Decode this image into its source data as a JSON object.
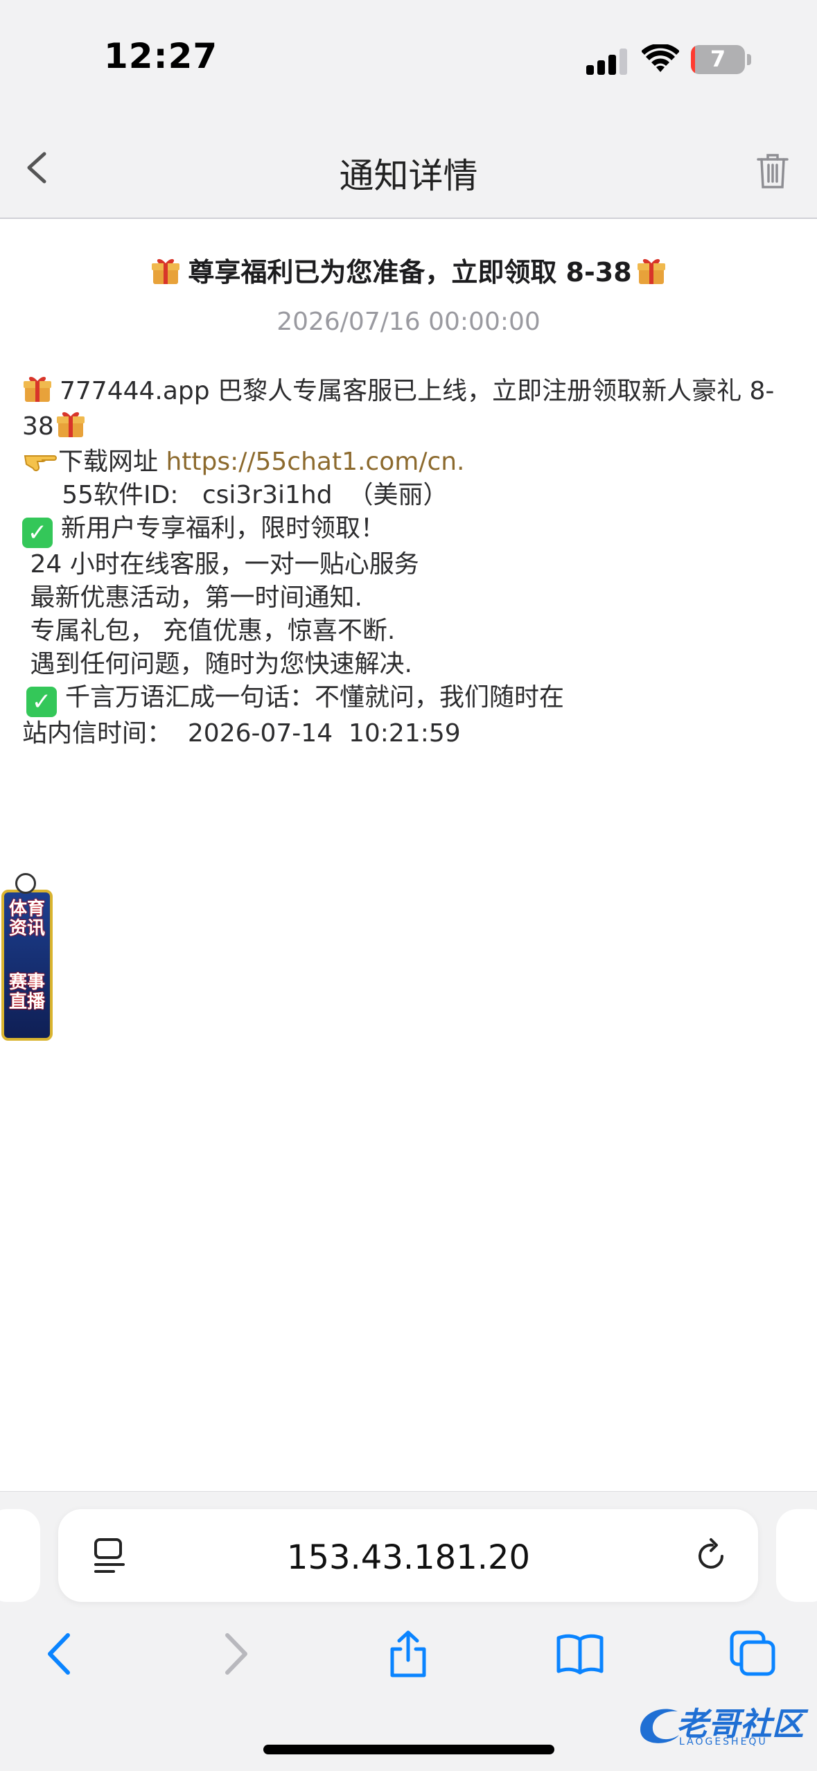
{
  "status_bar": {
    "time": "12:27",
    "battery_level": "7"
  },
  "header": {
    "title": "通知详情"
  },
  "message": {
    "title": "尊享福利已为您准备，立即领取 8-38",
    "date": "2026/07/16 00:00:00",
    "lines": {
      "l1a": "777444.app 巴黎人专属客服已上线，立即注册领取新人豪礼 8-",
      "l1b": "38",
      "l2_prefix": "下载网址 ",
      "l2_link": "https://55chat1.com/cn.",
      "l3": "     55软件ID:   csi3r3i1hd  （美丽）",
      "l4": "新用户专享福利，限时领取！",
      "l5": " 24 小时在线客服，一对一贴心服务",
      "l6": " 最新优惠活动，第一时间通知.",
      "l7": " 专属礼包， 充值优惠，惊喜不断.",
      "l8": " 遇到任何问题，随时为您快速解决.",
      "l9": "千言万语汇成一句话：不懂就问，我们随时在",
      "l10": "站内信时间：  2026-07-14  10:21:59"
    }
  },
  "side_banner": {
    "line1": "体育资讯",
    "line2": "赛事直播"
  },
  "browser": {
    "url": "153.43.181.20"
  },
  "watermark": {
    "text": "老哥社区",
    "sub": "LAOGESHEQU"
  },
  "colors": {
    "link": "#8c6a2e",
    "accent": "#0a84ff",
    "check": "#34c759"
  }
}
